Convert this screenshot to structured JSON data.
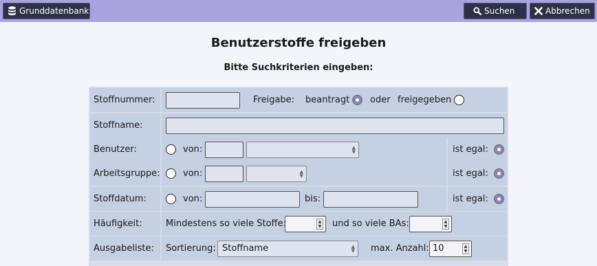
{
  "toolbar": {
    "grunddaten_label": "Grunddatenbank",
    "search_label": "Suchen",
    "cancel_label": "Abbrechen"
  },
  "page": {
    "title": "Benutzerstoffe freigeben",
    "subtitle": "Bitte Suchkriterien eingeben:"
  },
  "form": {
    "stoffnummer": {
      "label": "Stoffnummer:",
      "value": ""
    },
    "freigabe": {
      "label": "Freigabe:",
      "option1": "beantragt",
      "or": "oder",
      "option2": "freigegeben",
      "selected": "beantragt"
    },
    "stoffname": {
      "label": "Stoffname:",
      "value": ""
    },
    "benutzer": {
      "label": "Benutzer:",
      "von": "von:",
      "egal": "ist egal:",
      "id_value": "",
      "select_value": ""
    },
    "arbeitsgruppe": {
      "label": "Arbeitsgruppe:",
      "von": "von:",
      "egal": "ist egal:",
      "id_value": "",
      "select_value": ""
    },
    "stoffdatum": {
      "label": "Stoffdatum:",
      "von": "von:",
      "bis": "bis:",
      "egal": "ist egal:",
      "from_value": "",
      "to_value": ""
    },
    "haeufigkeit": {
      "label": "Häufigkeit:",
      "min_stoffe_label": "Mindestens so viele Stoffe:",
      "bas_label": "und so viele BAs:",
      "min_stoffe_value": "",
      "bas_value": ""
    },
    "ausgabeliste": {
      "label": "Ausgabeliste:",
      "sort_label": "Sortierung:",
      "sort_value": "Stoffname",
      "max_label": "max. Anzahl:",
      "max_value": "10"
    }
  },
  "colors": {
    "topbar": "#a9a3df",
    "button": "#2f3148",
    "row": "#c5d0e3",
    "radio_selected": "#8b86a8"
  },
  "icons": {
    "grunddaten": "database-icon",
    "search": "search-icon",
    "cancel": "close-icon"
  }
}
